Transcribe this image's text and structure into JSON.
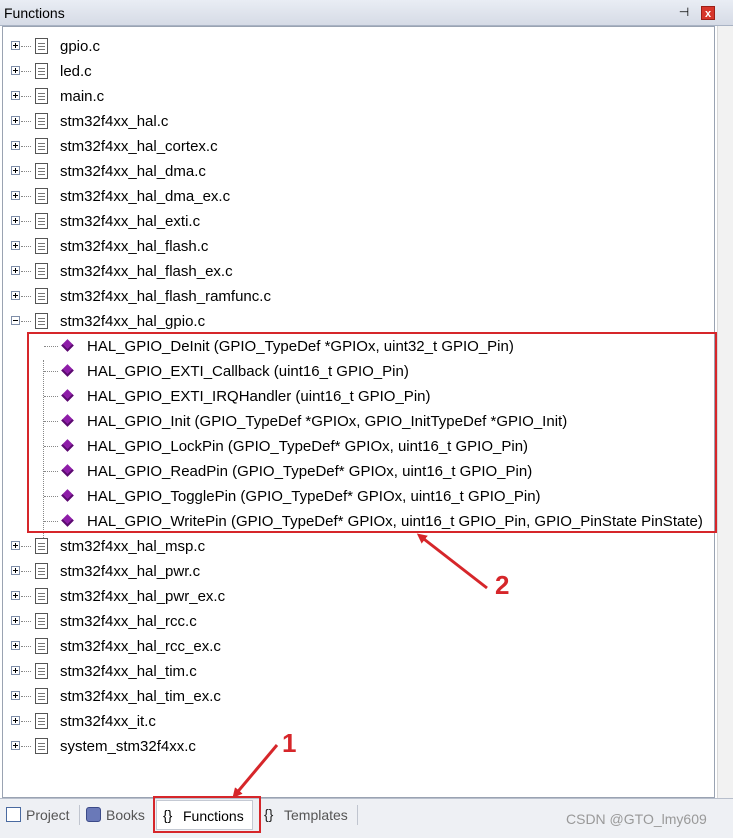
{
  "window": {
    "title": "Functions",
    "pin_glyph": "⊣",
    "close_glyph": "x"
  },
  "tree": {
    "files_before": [
      {
        "label": "gpio.c",
        "expanded": false
      },
      {
        "label": "led.c",
        "expanded": false
      },
      {
        "label": "main.c",
        "expanded": false
      },
      {
        "label": "stm32f4xx_hal.c",
        "expanded": false
      },
      {
        "label": "stm32f4xx_hal_cortex.c",
        "expanded": false
      },
      {
        "label": "stm32f4xx_hal_dma.c",
        "expanded": false
      },
      {
        "label": "stm32f4xx_hal_dma_ex.c",
        "expanded": false
      },
      {
        "label": "stm32f4xx_hal_exti.c",
        "expanded": false
      },
      {
        "label": "stm32f4xx_hal_flash.c",
        "expanded": false
      },
      {
        "label": "stm32f4xx_hal_flash_ex.c",
        "expanded": false
      },
      {
        "label": "stm32f4xx_hal_flash_ramfunc.c",
        "expanded": false
      }
    ],
    "expanded_file": {
      "label": "stm32f4xx_hal_gpio.c",
      "functions": [
        "HAL_GPIO_DeInit (GPIO_TypeDef *GPIOx, uint32_t GPIO_Pin)",
        "HAL_GPIO_EXTI_Callback (uint16_t GPIO_Pin)",
        "HAL_GPIO_EXTI_IRQHandler (uint16_t GPIO_Pin)",
        "HAL_GPIO_Init (GPIO_TypeDef *GPIOx, GPIO_InitTypeDef *GPIO_Init)",
        "HAL_GPIO_LockPin (GPIO_TypeDef* GPIOx, uint16_t GPIO_Pin)",
        "HAL_GPIO_ReadPin (GPIO_TypeDef* GPIOx, uint16_t GPIO_Pin)",
        "HAL_GPIO_TogglePin (GPIO_TypeDef* GPIOx, uint16_t GPIO_Pin)",
        "HAL_GPIO_WritePin (GPIO_TypeDef* GPIOx, uint16_t GPIO_Pin, GPIO_PinState PinState)"
      ]
    },
    "files_after": [
      {
        "label": "stm32f4xx_hal_msp.c",
        "expanded": false
      },
      {
        "label": "stm32f4xx_hal_pwr.c",
        "expanded": false
      },
      {
        "label": "stm32f4xx_hal_pwr_ex.c",
        "expanded": false
      },
      {
        "label": "stm32f4xx_hal_rcc.c",
        "expanded": false
      },
      {
        "label": "stm32f4xx_hal_rcc_ex.c",
        "expanded": false
      },
      {
        "label": "stm32f4xx_hal_tim.c",
        "expanded": false
      },
      {
        "label": "stm32f4xx_hal_tim_ex.c",
        "expanded": false
      },
      {
        "label": "stm32f4xx_it.c",
        "expanded": false
      },
      {
        "label": "system_stm32f4xx.c",
        "expanded": false
      }
    ]
  },
  "tabs": [
    {
      "label": "Project",
      "icon": "project-icon",
      "active": false
    },
    {
      "label": "Books",
      "icon": "books-icon",
      "active": false
    },
    {
      "label": "Functions",
      "icon": "functions-icon",
      "icon_glyph": "{}",
      "active": true
    },
    {
      "label": "Templates",
      "icon": "templates-icon",
      "icon_glyph": "{}",
      "active": false
    }
  ],
  "annotations": {
    "marker_1": "1",
    "marker_2": "2"
  },
  "watermark": "CSDN @GTO_lmy609",
  "colors": {
    "highlight": "#d6262a",
    "function_icon": "#8e1da8",
    "close_button": "#d7362b"
  }
}
